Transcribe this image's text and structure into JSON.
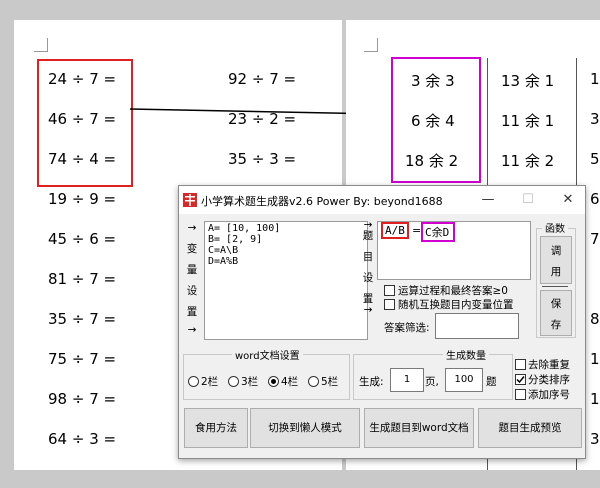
{
  "left_page": {
    "questions_col1": [
      "24 ÷ 7 =",
      "46 ÷ 7 =",
      "74 ÷ 4 =",
      "19 ÷ 9 =",
      "45 ÷ 6 =",
      "81 ÷ 7 =",
      "35 ÷ 7 =",
      "75 ÷ 7 =",
      "98 ÷ 7 =",
      "64 ÷ 3 ="
    ],
    "questions_col2": [
      "92 ÷ 7 =",
      "23 ÷ 2 =",
      "35 ÷ 3 ="
    ]
  },
  "right_page": {
    "answers_col1": [
      "3 余 3",
      "6 余 4",
      "18 余 2"
    ],
    "answers_col2": [
      "13 余 1",
      "11 余 1",
      "11 余 2"
    ],
    "answers_col3": [
      "1",
      "3",
      "5",
      "6",
      "7",
      "8",
      "1",
      "1",
      "3"
    ]
  },
  "dialog": {
    "title": "小学算术题生成器v2.6  Power By:  beyond1688",
    "minimize": "—",
    "maximize": "☐",
    "close": "✕",
    "vars_text": [
      "A= [10, 100]",
      "B= [2, 9]",
      "C=A\\B",
      "D=A%B"
    ],
    "left_arrow_top": "→",
    "left_arrow_bottom": "→",
    "vars_label_chars": [
      "变",
      "量",
      "设",
      "置"
    ],
    "problem_label_chars": [
      "题",
      "目",
      "设",
      "置"
    ],
    "problem_expr_a": "A/B",
    "problem_equals": "=",
    "problem_expr_b": "C余D",
    "func_label": "函数",
    "btn_call": [
      "调",
      "用"
    ],
    "btn_save": [
      "保",
      "存"
    ],
    "chk_process": "运算过程和最终答案≥0",
    "chk_swap": "随机互换题目内变量位置",
    "answer_filter_label": "答案筛选:",
    "answer_filter_value": "",
    "word_settings_title": "word文档设置",
    "columns": [
      "2栏",
      "3栏",
      "4栏",
      "5栏"
    ],
    "selected_column": "4栏",
    "gen_count_title": "生成数量",
    "generate_label": "生成:",
    "pages_value": "1",
    "pages_unit": "页,",
    "questions_value": "100",
    "questions_unit": "题",
    "chk_dedupe": "去除重复",
    "chk_sort": "分类排序",
    "chk_serial": "添加序号",
    "btn_usage": "食用方法",
    "btn_lazy": "切换到懒人模式",
    "btn_gen_word": "生成题目到word文档",
    "btn_preview": "题目生成预览"
  }
}
